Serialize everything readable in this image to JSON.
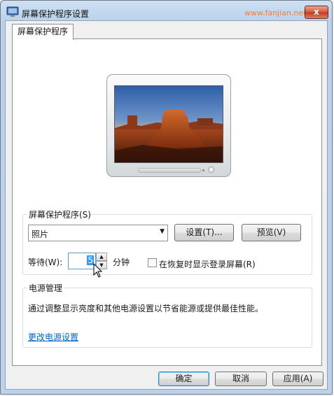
{
  "window": {
    "title": "屏幕保护程序设置",
    "watermark": "www.fanjian.net",
    "close_glyph": "x"
  },
  "tab": {
    "label": "屏幕保护程序"
  },
  "screensaver": {
    "group_label": "屏幕保护程序(S)",
    "selected": "照片",
    "settings_button": "设置(T)...",
    "preview_button": "预览(V)",
    "wait_label": "等待(W):",
    "wait_value": "5",
    "wait_unit": "分钟",
    "resume_checkbox_label": "在恢复时显示登录屏幕(R)",
    "resume_checked": false
  },
  "power": {
    "group_label": "电源管理",
    "description": "通过调整显示亮度和其他电源设置以节省能源或提供最佳性能。",
    "link": "更改电源设置"
  },
  "footer": {
    "ok_button": "确定",
    "cancel_button": "取消",
    "apply_button": "应用(A)"
  },
  "colors": {
    "accent": "#3399ff",
    "link": "#0066cc",
    "close": "#c0391e"
  }
}
